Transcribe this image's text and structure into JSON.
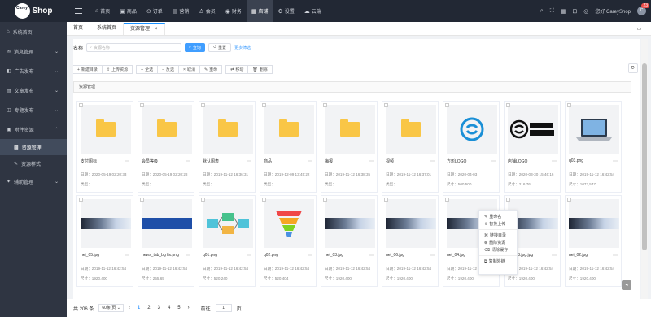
{
  "header": {
    "logo_line1": "Carey",
    "logo_line2": "Shop",
    "menu": [
      {
        "icon": "home",
        "label": "首页"
      },
      {
        "icon": "goods",
        "label": "商品"
      },
      {
        "icon": "order",
        "label": "订单"
      },
      {
        "icon": "marketing",
        "label": "营销"
      },
      {
        "icon": "member",
        "label": "会员"
      },
      {
        "icon": "finance",
        "label": "财务"
      },
      {
        "icon": "store",
        "label": "店铺"
      },
      {
        "icon": "settings",
        "label": "设置"
      },
      {
        "icon": "cloud",
        "label": "云端"
      }
    ],
    "greeting": "您好 CareyShop",
    "badge": "23"
  },
  "sidebar": {
    "items": [
      {
        "label": "系统首页"
      },
      {
        "label": "消息管理"
      },
      {
        "label": "广告发布"
      },
      {
        "label": "文章发布"
      },
      {
        "label": "专题发布"
      },
      {
        "label": "附件资源"
      },
      {
        "label": "资源管理"
      },
      {
        "label": "资源样式"
      },
      {
        "label": "辅助管理"
      }
    ]
  },
  "tabs": [
    "首页",
    "系统首页",
    "资源管理"
  ],
  "search": {
    "label": "名称",
    "placeholder": "资源名称",
    "search_btn": "查询",
    "reset_btn": "重置",
    "more": "更多筛选"
  },
  "toolbar": {
    "new_dir": "新建目录",
    "upload": "上传资源",
    "select_all": "全选",
    "invert": "反选",
    "cancel": "取消",
    "rename": "重命",
    "move": "移动",
    "delete": "删除"
  },
  "breadcrumb": "资源管理",
  "cards_row1": [
    {
      "name": "支付图标",
      "date": "日期：2020-05-19 02:20:33",
      "size": "类型：",
      "type": "folder"
    },
    {
      "name": "会员等级",
      "date": "日期：2020-05-19 02:20:28",
      "size": "类型：",
      "type": "folder"
    },
    {
      "name": "默认图表",
      "date": "日期：2019-11-12 16:36:31",
      "size": "类型：",
      "type": "folder"
    },
    {
      "name": "商品",
      "date": "日期：2019-12-09 13:45:22",
      "size": "类型：",
      "type": "folder"
    },
    {
      "name": "海报",
      "date": "日期：2019-11-12 16:38:35",
      "size": "类型：",
      "type": "folder"
    },
    {
      "name": "视频",
      "date": "日期：2019-11-12 16:37:01",
      "size": "类型：",
      "type": "folder"
    },
    {
      "name": "方形LOGO",
      "date": "日期：2020-04-03",
      "size": "尺寸：500,500",
      "type": "logo-square"
    },
    {
      "name": "店铺LOGO",
      "date": "日期：2020-03-30 15:46:16",
      "size": "尺寸：216,76",
      "type": "logo-shop"
    },
    {
      "name": "q03.png",
      "date": "日期：2019-11-12 16:42:54",
      "size": "尺寸：1073,547",
      "type": "laptop"
    }
  ],
  "cards_row2": [
    {
      "name": "nei_05.jpg",
      "date": "日期：2019-11-12 16:42:54",
      "size": "尺寸：1920,400",
      "type": "banner"
    },
    {
      "name": "news_tab_bg fix.png",
      "date": "日期：2019-11-12 16:42:54",
      "size": "尺寸：255,65",
      "type": "bluebar"
    },
    {
      "name": "q01.png",
      "date": "日期：2019-11-12 16:42:54",
      "size": "尺寸：520,240",
      "type": "diagram"
    },
    {
      "name": "q02.png",
      "date": "日期：2019-11-12 16:42:54",
      "size": "尺寸：520,404",
      "type": "funnel"
    },
    {
      "name": "nei_03.jpg",
      "date": "日期：2019-11-12 16:42:54",
      "size": "尺寸：1920,400",
      "type": "banner"
    },
    {
      "name": "nei_06.jpg",
      "date": "日期：2019-11-12 16:42:54",
      "size": "尺寸：1920,400",
      "type": "banner"
    },
    {
      "name": "nei_04.jpg",
      "date": "日期：2019-11-12 16:42:54",
      "size": "尺寸：1920,400",
      "type": "banner"
    },
    {
      "name": "nei_03.jpg.jpg",
      "date": "日期：2019-11-12 16:42:54",
      "size": "尺寸：1920,400",
      "type": "banner"
    },
    {
      "name": "nei_02.jpg",
      "date": "日期：2019-11-12 16:42:54",
      "size": "尺寸：1920,400",
      "type": "banner"
    }
  ],
  "context_menu": [
    "重命名",
    "替换上传",
    "链接目录",
    "删除资源",
    "清除缓存",
    "复制外链"
  ],
  "footer": {
    "total": "共 206 条",
    "per_page": "60条/页",
    "pages": [
      "1",
      "2",
      "3",
      "4",
      "5"
    ],
    "current": "1",
    "goto_label": "前往",
    "goto_value": "1",
    "page_suffix": "页"
  }
}
